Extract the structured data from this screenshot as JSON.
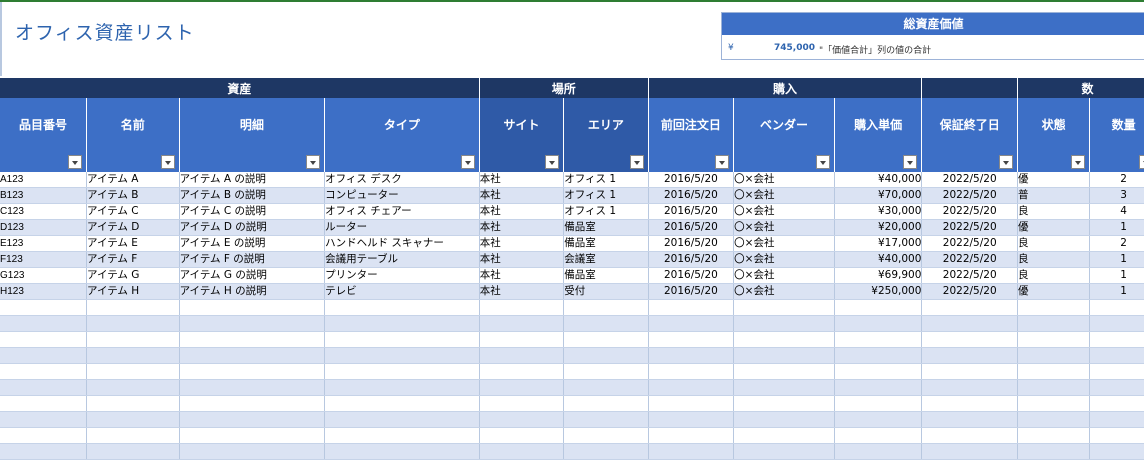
{
  "title": "オフィス資産リスト",
  "total": {
    "header": "総資産価値",
    "currency": "¥",
    "value": "745,000",
    "note": "\"「価値合計」列の値の合計"
  },
  "groups": [
    {
      "label": "資産",
      "span": 4
    },
    {
      "label": "場所",
      "span": 2
    },
    {
      "label": "購入",
      "span": 3
    },
    {
      "label": "",
      "span": 1
    },
    {
      "label": "数",
      "span": 2
    }
  ],
  "columns": [
    "品目番号",
    "名前",
    "明細",
    "タイプ",
    "サイト",
    "エリア",
    "前回注文日",
    "ベンダー",
    "購入単価",
    "保証終了日",
    "状態",
    "数量"
  ],
  "rows": [
    [
      "A123",
      "アイテム A",
      "アイテム A の説明",
      "オフィス デスク",
      "本社",
      "オフィス 1",
      "2016/5/20",
      "〇×会社",
      "¥40,000",
      "2022/5/20",
      "優",
      "2"
    ],
    [
      "B123",
      "アイテム B",
      "アイテム B の説明",
      "コンピューター",
      "本社",
      "オフィス 1",
      "2016/5/20",
      "〇×会社",
      "¥70,000",
      "2022/5/20",
      "普",
      "3"
    ],
    [
      "C123",
      "アイテム C",
      "アイテム C の説明",
      "オフィス チェアー",
      "本社",
      "オフィス 1",
      "2016/5/20",
      "〇×会社",
      "¥30,000",
      "2022/5/20",
      "良",
      "4"
    ],
    [
      "D123",
      "アイテム D",
      "アイテム D の説明",
      "ルーター",
      "本社",
      "備品室",
      "2016/5/20",
      "〇×会社",
      "¥20,000",
      "2022/5/20",
      "優",
      "1"
    ],
    [
      "E123",
      "アイテム E",
      "アイテム E の説明",
      "ハンドヘルド スキャナー",
      "本社",
      "備品室",
      "2016/5/20",
      "〇×会社",
      "¥17,000",
      "2022/5/20",
      "良",
      "2"
    ],
    [
      "F123",
      "アイテム F",
      "アイテム F の説明",
      "会議用テーブル",
      "本社",
      "会議室",
      "2016/5/20",
      "〇×会社",
      "¥40,000",
      "2022/5/20",
      "良",
      "1"
    ],
    [
      "G123",
      "アイテム G",
      "アイテム G の説明",
      "プリンター",
      "本社",
      "備品室",
      "2016/5/20",
      "〇×会社",
      "¥69,900",
      "2022/5/20",
      "良",
      "1"
    ],
    [
      "H123",
      "アイテム H",
      "アイテム H の説明",
      "テレビ",
      "本社",
      "受付",
      "2016/5/20",
      "〇×会社",
      "¥250,000",
      "2022/5/20",
      "優",
      "1"
    ]
  ],
  "empty_rows": 10
}
